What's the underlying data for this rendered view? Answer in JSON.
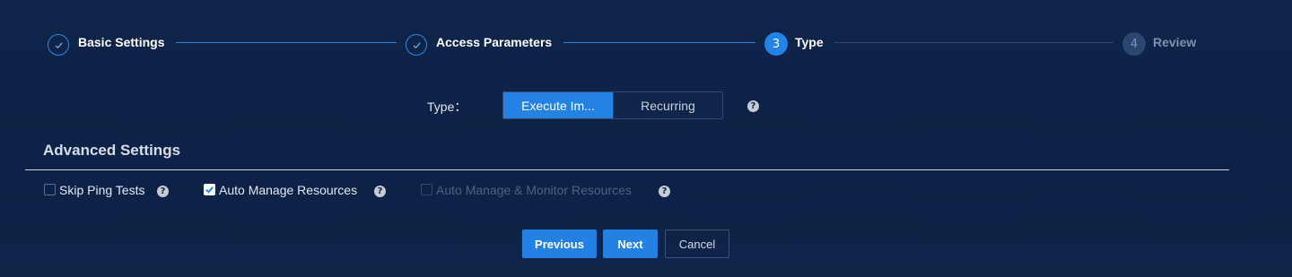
{
  "stepper": {
    "steps": [
      {
        "number": "1",
        "label": "Basic Settings",
        "state": "done"
      },
      {
        "number": "2",
        "label": "Access Parameters",
        "state": "done"
      },
      {
        "number": "3",
        "label": "Type",
        "state": "active"
      },
      {
        "number": "4",
        "label": "Review",
        "state": "todo"
      }
    ]
  },
  "type": {
    "label": "Type：",
    "options": [
      "Execute Im...",
      "Recurring"
    ],
    "selected": "Execute Im...",
    "help_icon": "?"
  },
  "advanced": {
    "title": "Advanced Settings",
    "options": [
      {
        "label": "Skip Ping Tests",
        "checked": false,
        "disabled": false
      },
      {
        "label": "Auto Manage Resources",
        "checked": true,
        "disabled": false
      },
      {
        "label": "Auto Manage & Monitor Resources",
        "checked": false,
        "disabled": true
      }
    ],
    "help_icon": "?"
  },
  "footer": {
    "previous_label": "Previous",
    "next_label": "Next",
    "cancel_label": "Cancel"
  },
  "colors": {
    "background": "#0e2347",
    "accent": "#2381e4",
    "inactive_step": "#2b4670"
  }
}
